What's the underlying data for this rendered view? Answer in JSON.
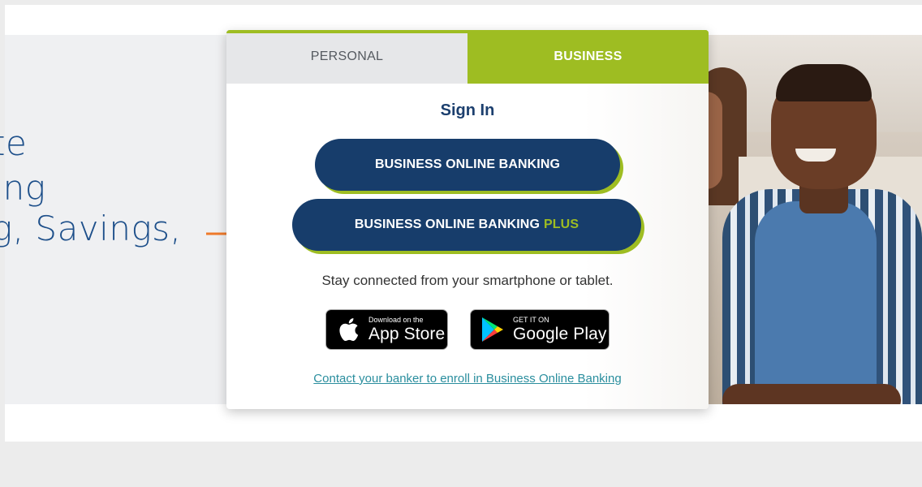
{
  "hero": {
    "line1": "te",
    "line2": "ening",
    "line3": "g, Savings,"
  },
  "tabs": {
    "personal": "PERSONAL",
    "business": "BUSINESS"
  },
  "signin": {
    "title": "Sign In",
    "button1": "BUSINESS ONLINE BANKING",
    "button2_main": "BUSINESS ONLINE BANKING",
    "button2_plus": "PLUS"
  },
  "apps": {
    "tagline": "Stay connected from your smartphone or tablet.",
    "apple_small": "Download on the",
    "apple_big": "App Store",
    "google_small": "GET IT ON",
    "google_big": "Google Play"
  },
  "enroll_link": "Contact your banker to enroll in Business Online Banking",
  "colors": {
    "navy": "#173d6b",
    "green": "#9ebd22",
    "teal_link": "#2a8e9e",
    "arrow": "#ef7a2b"
  }
}
